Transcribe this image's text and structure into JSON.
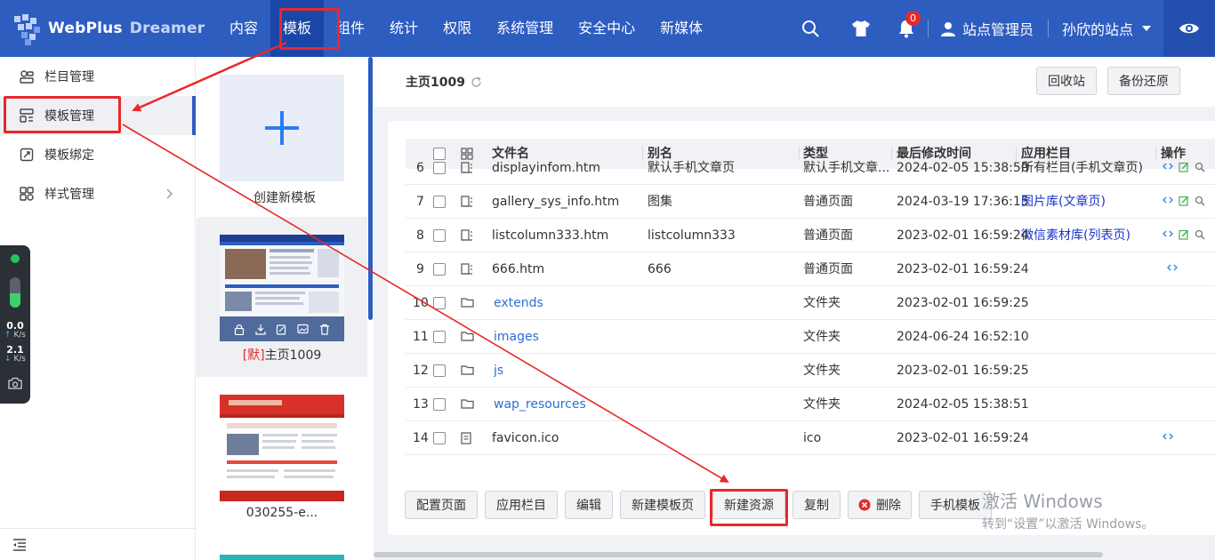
{
  "app": {
    "logo_text": "WebPlus",
    "logo_sub": "Dreamer"
  },
  "topnav": {
    "items": [
      "内容",
      "模板",
      "组件",
      "统计",
      "权限",
      "系统管理",
      "安全中心",
      "新媒体"
    ],
    "active": "模板"
  },
  "topbar": {
    "notifications": "0",
    "user": "站点管理员",
    "site": "孙欣的站点"
  },
  "sidebar": {
    "items": [
      {
        "label": "栏目管理",
        "icon": "column-icon"
      },
      {
        "label": "模板管理",
        "icon": "template-icon"
      },
      {
        "label": "模板绑定",
        "icon": "binding-icon"
      },
      {
        "label": "样式管理",
        "icon": "style-icon"
      }
    ],
    "active": "模板管理"
  },
  "network": {
    "up_value": "0.0",
    "up_unit": "K/s",
    "down_value": "2.1",
    "down_unit": "K/s"
  },
  "templates": {
    "new_label": "创建新模板",
    "items": [
      {
        "default_tag": "[默]",
        "name": "主页1009"
      },
      {
        "default_tag": "",
        "name": "030255-e..."
      }
    ]
  },
  "main": {
    "title": "主页1009",
    "recycle_btn": "回收站",
    "backup_btn": "备份还原",
    "columns": [
      "文件名",
      "别名",
      "类型",
      "最后修改时间",
      "应用栏目",
      "操作"
    ],
    "rows": [
      {
        "idx": "6",
        "type_icon": "page",
        "name": "displayinfom.htm",
        "alias": "默认手机文章页",
        "kind": "默认手机文章...",
        "mtime": "2024-02-05 15:38:50",
        "column": "所有栏目(手机文章页)",
        "column_link": false,
        "ops": 3,
        "name_link": false
      },
      {
        "idx": "7",
        "type_icon": "page",
        "name": "gallery_sys_info.htm",
        "alias": "图集",
        "kind": "普通页面",
        "mtime": "2024-03-19 17:36:15",
        "column": "图片库(文章页)",
        "column_link": true,
        "ops": 3,
        "name_link": false
      },
      {
        "idx": "8",
        "type_icon": "page",
        "name": "listcolumn333.htm",
        "alias": "listcolumn333",
        "kind": "普通页面",
        "mtime": "2023-02-01 16:59:24",
        "column": "微信素材库(列表页)",
        "column_link": true,
        "ops": 3,
        "name_link": false
      },
      {
        "idx": "9",
        "type_icon": "page",
        "name": "666.htm",
        "alias": "666",
        "kind": "普通页面",
        "mtime": "2023-02-01 16:59:24",
        "column": "",
        "column_link": false,
        "ops": 1,
        "name_link": false
      },
      {
        "idx": "10",
        "type_icon": "folder",
        "name": "extends",
        "alias": "",
        "kind": "文件夹",
        "mtime": "2023-02-01 16:59:25",
        "column": "",
        "column_link": false,
        "ops": 0,
        "name_link": true
      },
      {
        "idx": "11",
        "type_icon": "folder",
        "name": "images",
        "alias": "",
        "kind": "文件夹",
        "mtime": "2024-06-24 16:52:10",
        "column": "",
        "column_link": false,
        "ops": 0,
        "name_link": true
      },
      {
        "idx": "12",
        "type_icon": "folder",
        "name": "js",
        "alias": "",
        "kind": "文件夹",
        "mtime": "2023-02-01 16:59:25",
        "column": "",
        "column_link": false,
        "ops": 0,
        "name_link": true
      },
      {
        "idx": "13",
        "type_icon": "folder",
        "name": "wap_resources",
        "alias": "",
        "kind": "文件夹",
        "mtime": "2024-02-05 15:38:51",
        "column": "",
        "column_link": false,
        "ops": 0,
        "name_link": true
      },
      {
        "idx": "14",
        "type_icon": "file",
        "name": "favicon.ico",
        "alias": "",
        "kind": "ico",
        "mtime": "2023-02-01 16:59:24",
        "column": "",
        "column_link": false,
        "ops": 1,
        "name_link": false
      }
    ],
    "actions": [
      "配置页面",
      "应用栏目",
      "编辑",
      "新建模板页",
      "新建资源",
      "复制",
      "删除",
      "手机模板"
    ]
  },
  "watermark": {
    "line1": "激活 Windows",
    "line2": "转到“设置”以激活 Windows。"
  },
  "colors": {
    "topbar": "#2e5dc0",
    "highlight": "#e8292a",
    "link": "#2e6fd6"
  }
}
